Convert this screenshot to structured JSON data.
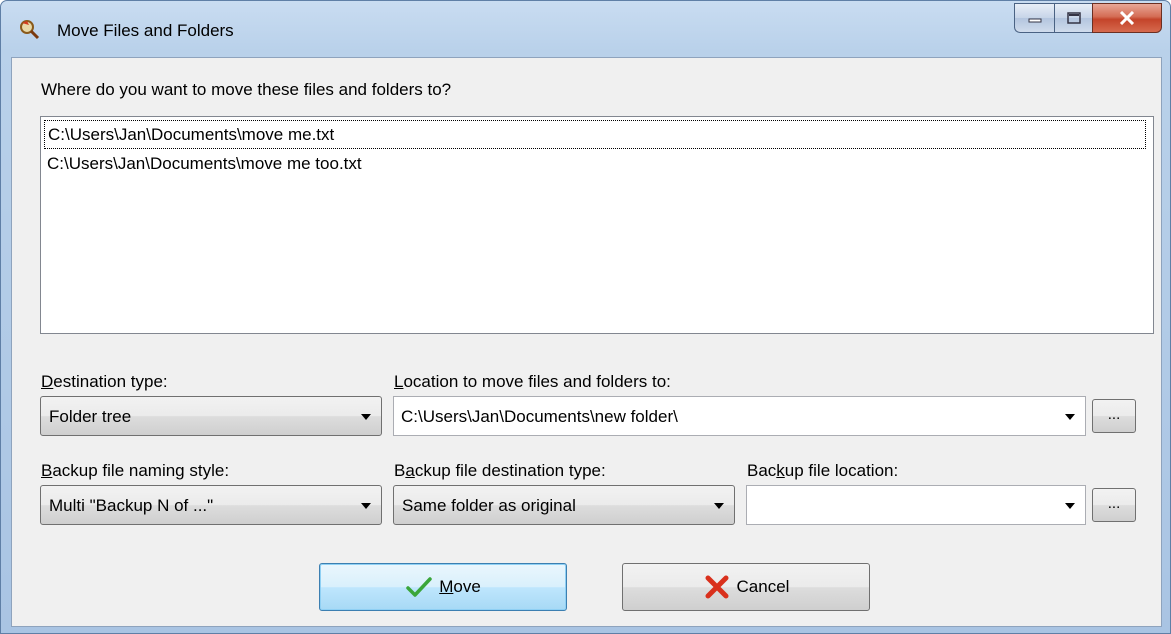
{
  "window": {
    "title": "Move Files and Folders"
  },
  "question": "Where do you want to move these files and folders to?",
  "files": [
    "C:\\Users\\Jan\\Documents\\move me.txt",
    "C:\\Users\\Jan\\Documents\\move me too.txt"
  ],
  "destination_type": {
    "label_accel": "D",
    "label_rest": "estination type:",
    "value": "Folder tree"
  },
  "location": {
    "label_accel": "L",
    "label_rest": "ocation to move files and folders to:",
    "value": "C:\\Users\\Jan\\Documents\\new folder\\",
    "browse_label": "..."
  },
  "backup_naming": {
    "label_accel": "B",
    "label_rest": "ackup file naming style:",
    "value": "Multi \"Backup N of ...\""
  },
  "backup_dest_type": {
    "label_pre": "B",
    "label_accel": "a",
    "label_rest": "ckup file destination type:",
    "value": "Same folder as original"
  },
  "backup_location": {
    "label_pre": "Bac",
    "label_accel": "k",
    "label_rest": "up file location:",
    "value": "",
    "browse_label": "..."
  },
  "buttons": {
    "move_accel": "M",
    "move_rest": "ove",
    "cancel": "Cancel"
  },
  "icons": {
    "app": "magnifier-folder-icon",
    "move": "checkmark-icon",
    "cancel": "red-x-icon"
  },
  "colors": {
    "check_green": "#3aa63a",
    "cancel_red": "#d9301c",
    "default_button_border": "#3c7fb1"
  }
}
